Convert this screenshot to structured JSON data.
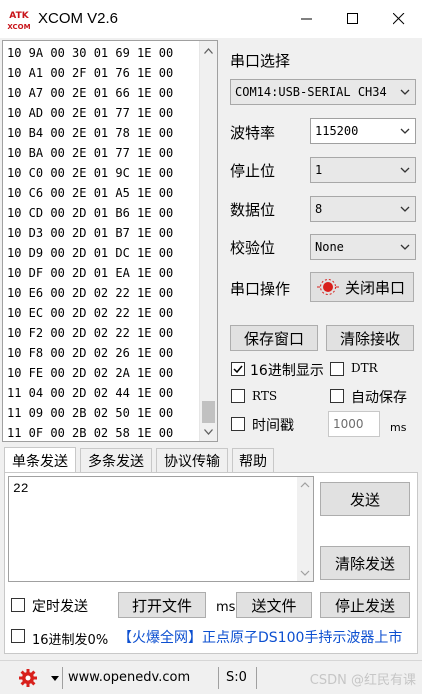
{
  "window": {
    "title": "XCOM V2.6",
    "logo_text_top": "ATK",
    "logo_text_bottom": "XCOM"
  },
  "receive": {
    "lines": [
      "10 9A 00 30 01 69 1E 00",
      "10 A1 00 2F 01 76 1E 00",
      "10 A7 00 2E 01 66 1E 00",
      "10 AD 00 2E 01 77 1E 00",
      "10 B4 00 2E 01 78 1E 00",
      "10 BA 00 2E 01 77 1E 00",
      "10 C0 00 2E 01 9C 1E 00",
      "10 C6 00 2E 01 A5 1E 00",
      "10 CD 00 2D 01 B6 1E 00",
      "10 D3 00 2D 01 B7 1E 00",
      "10 D9 00 2D 01 DC 1E 00",
      "10 DF 00 2D 01 EA 1E 00",
      "10 E6 00 2D 02 22 1E 00",
      "10 EC 00 2D 02 22 1E 00",
      "10 F2 00 2D 02 22 1E 00",
      "10 F8 00 2D 02 26 1E 00",
      "10 FE 00 2D 02 2A 1E 00",
      "11 04 00 2D 02 44 1E 00",
      "11 09 00 2B 02 50 1E 00",
      "11 0F 00 2B 02 58 1E 00"
    ]
  },
  "serial": {
    "port_label": "串口选择",
    "port_value": "COM14:USB-SERIAL CH34",
    "baud_label": "波特率",
    "baud_value": "115200",
    "stopbits_label": "停止位",
    "stopbits_value": "1",
    "databits_label": "数据位",
    "databits_value": "8",
    "parity_label": "校验位",
    "parity_value": "None",
    "op_label": "串口操作",
    "close_port": "关闭串口"
  },
  "options": {
    "save_window": "保存窗口",
    "clear_receive": "清除接收",
    "hex_display": "16进制显示",
    "hex_display_checked": true,
    "dtr": "DTR",
    "rts": "RTS",
    "auto_save": "自动保存",
    "timestamp": "时间戳",
    "timestamp_ms_value": "1000",
    "ms_unit": "ms"
  },
  "tabs": [
    "单条发送",
    "多条发送",
    "协议传输",
    "帮助"
  ],
  "send": {
    "text": "22",
    "send_button": "发送",
    "clear_send": "清除发送",
    "timed_send": "定时发送",
    "ms_unit": "ms",
    "open_file": "打开文件",
    "send_file": "送文件",
    "stop_send": "停止发送",
    "hex_send": "16进制发0%",
    "ad_link": "【火爆全网】正点原子DS100手持示波器上市"
  },
  "status": {
    "url": "www.openedv.com",
    "s_count": "S:0",
    "watermark": "CSDN @红民有课"
  },
  "colors": {
    "accent_red": "#d8201c",
    "link_blue": "#0c4fd0"
  }
}
